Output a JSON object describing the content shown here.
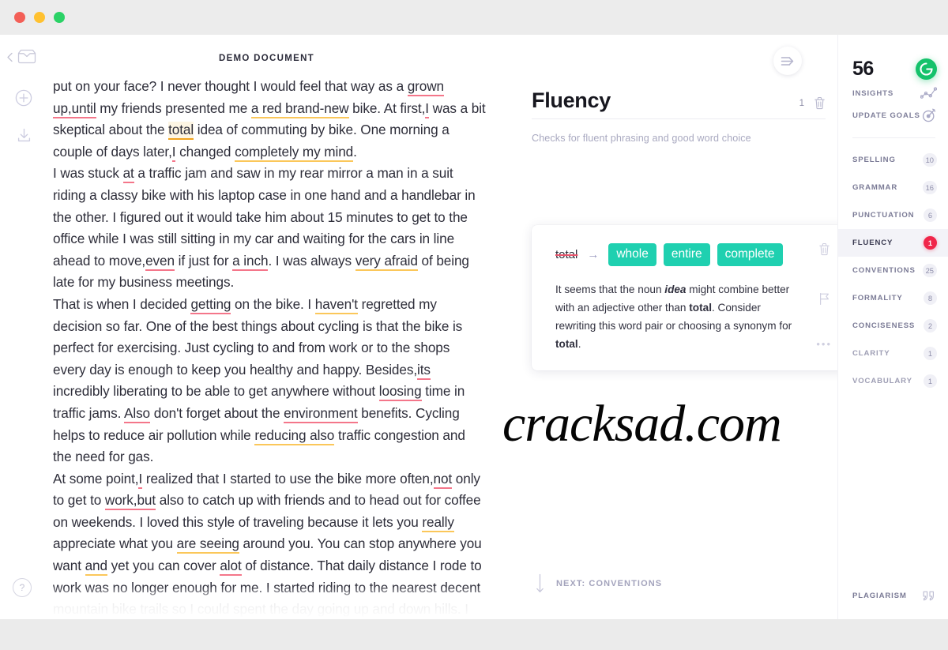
{
  "window": {
    "controls": [
      "close",
      "minimize",
      "maximize"
    ]
  },
  "rail": {
    "back_icon": "chevron-left-icon",
    "inbox_icon": "inbox-icon",
    "new_doc_icon": "plus-circle-icon",
    "download_icon": "download-icon",
    "help_icon": "question-mark-icon",
    "help_label": "?"
  },
  "document": {
    "title": "DEMO DOCUMENT",
    "paragraphs": [
      {
        "id": "p1",
        "runs": [
          {
            "t": "put on your face? I never thought I would feel that way as a ",
            "mark": "none"
          },
          {
            "t": "grown up,until",
            "mark": "red"
          },
          {
            "t": " my friends presented me ",
            "mark": "none"
          },
          {
            "t": "a red brand-new",
            "mark": "yellow"
          },
          {
            "t": " bike. At first,",
            "mark": "none"
          },
          {
            "t": "I",
            "mark": "red"
          },
          {
            "t": " was a bit skeptical about the ",
            "mark": "none"
          },
          {
            "t": "total",
            "mark": "active"
          },
          {
            "t": " idea of commuting by bike. One morning a couple of days later,",
            "mark": "none"
          },
          {
            "t": "I",
            "mark": "red"
          },
          {
            "t": " changed ",
            "mark": "none"
          },
          {
            "t": "completely my mind",
            "mark": "yellow"
          },
          {
            "t": ".",
            "mark": "none"
          }
        ]
      },
      {
        "id": "p2",
        "runs": [
          {
            "t": "I was stuck ",
            "mark": "none"
          },
          {
            "t": "at",
            "mark": "red"
          },
          {
            "t": " a traffic jam and saw in my rear mirror a man in a suit riding a classy bike with his laptop case in one hand and a handlebar in the other. I figured out it would take him about 15 minutes to get to the office while I was still sitting in my car and waiting for the cars in line ahead to move,",
            "mark": "none"
          },
          {
            "t": "even",
            "mark": "red"
          },
          {
            "t": " if just for ",
            "mark": "none"
          },
          {
            "t": "a inch",
            "mark": "red"
          },
          {
            "t": ". I was always ",
            "mark": "none"
          },
          {
            "t": "very afraid",
            "mark": "yellow"
          },
          {
            "t": " of being late for my business meetings.",
            "mark": "none"
          }
        ]
      },
      {
        "id": "p3",
        "runs": [
          {
            "t": "That is when I decided ",
            "mark": "none"
          },
          {
            "t": "getting",
            "mark": "red"
          },
          {
            "t": " on the bike. I ",
            "mark": "none"
          },
          {
            "t": "haven't",
            "mark": "yellow"
          },
          {
            "t": " regretted my decision so far. One of the best things about cycling is that the bike is perfect for exercising. Just cycling to and from work or to the shops every day is enough to keep you healthy and happy. Besides,",
            "mark": "none"
          },
          {
            "t": "its",
            "mark": "red"
          },
          {
            "t": " incredibly liberating to be able to get anywhere without ",
            "mark": "none"
          },
          {
            "t": "loosing",
            "mark": "red"
          },
          {
            "t": " time in traffic jams. ",
            "mark": "none"
          },
          {
            "t": "Also",
            "mark": "red"
          },
          {
            "t": " don't forget about the ",
            "mark": "none"
          },
          {
            "t": "environment",
            "mark": "red"
          },
          {
            "t": " benefits. Cycling helps to reduce air pollution while ",
            "mark": "none"
          },
          {
            "t": "reducing also",
            "mark": "yellow"
          },
          {
            "t": " traffic congestion and the need for gas.",
            "mark": "none"
          }
        ]
      },
      {
        "id": "p4",
        "runs": [
          {
            "t": "At some point,",
            "mark": "none"
          },
          {
            "t": "I",
            "mark": "red"
          },
          {
            "t": " realized that I started to use the bike more often,",
            "mark": "none"
          },
          {
            "t": "not",
            "mark": "red"
          },
          {
            "t": " only to get to ",
            "mark": "none"
          },
          {
            "t": "work,but",
            "mark": "red"
          },
          {
            "t": " also to catch up with friends and to head out for coffee on weekends. I loved this style of traveling because it lets you ",
            "mark": "none"
          },
          {
            "t": "really",
            "mark": "yellow"
          },
          {
            "t": " appreciate what you ",
            "mark": "none"
          },
          {
            "t": "are seeing",
            "mark": "yellow"
          },
          {
            "t": " around you. You can stop anywhere you want ",
            "mark": "none"
          },
          {
            "t": "and",
            "mark": "yellow"
          },
          {
            "t": " yet you can cover ",
            "mark": "none"
          },
          {
            "t": "alot",
            "mark": "red"
          },
          {
            "t": " of distance. That daily distance I rode to work was no longer enough for me. I started riding to the nearest decent mountain bike trails so I could spent the day going up and down hills. I did",
            "mark": "none"
          }
        ]
      }
    ]
  },
  "assistant": {
    "collapse_icon": "collapse-right-icon",
    "category_title": "Fluency",
    "category_count": "1",
    "delete_icon": "trash-icon",
    "category_description": "Checks for fluent phrasing and good word choice",
    "card": {
      "original_word": "total",
      "arrow_icon": "arrow-right-icon",
      "suggestions": [
        "whole",
        "entire",
        "complete"
      ],
      "explanation_parts": [
        {
          "t": "It seems that the noun ",
          "style": "normal"
        },
        {
          "t": "idea",
          "style": "italic-bold"
        },
        {
          "t": " might combine better with an adjective other than ",
          "style": "normal"
        },
        {
          "t": "total",
          "style": "bold"
        },
        {
          "t": ". Consider rewriting this word pair or choosing a synonym for ",
          "style": "normal"
        },
        {
          "t": "total",
          "style": "bold"
        },
        {
          "t": ".",
          "style": "normal"
        }
      ],
      "trash_icon": "trash-icon",
      "flag_icon": "flag-icon",
      "more_icon": "ellipsis-icon",
      "more_label": "•••"
    },
    "next_label": "NEXT: CONVENTIONS",
    "next_icon": "arrow-down-icon"
  },
  "watermark": {
    "text": "cracksad.com"
  },
  "score_panel": {
    "score": "56",
    "brand_icon": "grammarly-g-icon",
    "brand_letter": "G",
    "meta": [
      {
        "label": "INSIGHTS",
        "icon": "insights-chart-icon"
      },
      {
        "label": "UPDATE GOALS",
        "icon": "target-goal-icon"
      }
    ],
    "categories": [
      {
        "label": "SPELLING",
        "count": "10",
        "active": false,
        "dim": false
      },
      {
        "label": "GRAMMAR",
        "count": "16",
        "active": false,
        "dim": false
      },
      {
        "label": "PUNCTUATION",
        "count": "6",
        "active": false,
        "dim": false
      },
      {
        "label": "FLUENCY",
        "count": "1",
        "active": true,
        "dim": false
      },
      {
        "label": "CONVENTIONS",
        "count": "25",
        "active": false,
        "dim": false
      },
      {
        "label": "FORMALITY",
        "count": "8",
        "active": false,
        "dim": false
      },
      {
        "label": "CONCISENESS",
        "count": "2",
        "active": false,
        "dim": false
      },
      {
        "label": "CLARITY",
        "count": "1",
        "active": false,
        "dim": true
      },
      {
        "label": "VOCABULARY",
        "count": "1",
        "active": false,
        "dim": true
      }
    ],
    "plagiarism_label": "PLAGIARISM",
    "plagiarism_icon": "quote-icon"
  },
  "colors": {
    "accent_teal": "#1fd0b0",
    "brand_green": "#15c26b",
    "alert_red": "#f0264a",
    "underline_red": "#f4768a",
    "underline_yellow": "#fbc75a",
    "active_underline": "#f0a21d"
  }
}
